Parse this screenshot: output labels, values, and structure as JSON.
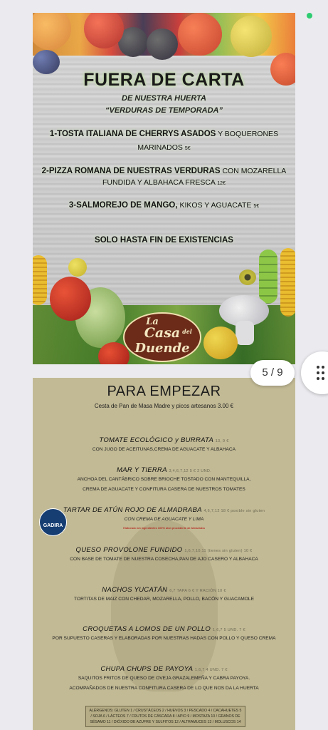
{
  "status": {
    "indicator_color": "#2ecc71"
  },
  "card_fuera": {
    "title": "FUERA DE CARTA",
    "subtitle1": "DE NUESTRA HUERTA",
    "subtitle2": "“VERDURAS DE TEMPORADA”",
    "items": [
      {
        "bold": "1-TOSTA ITALIANA DE CHERRYS ASADOS",
        "rest": " Y BOQUERONES",
        "line2": "MARINADOS",
        "price": "5€"
      },
      {
        "bold": "2-PIZZA ROMANA DE NUESTRAS VERDURAS",
        "rest": " CON MOZARELLA",
        "line2": "FUNDIDA Y ALBAHACA FRESCA",
        "price": "12€"
      },
      {
        "bold": "3-SALMOREJO DE MANGO,",
        "rest": " KIKOS Y AGUACATE",
        "price": "5€"
      }
    ],
    "note": "SOLO HASTA FIN DE EXISTENCIAS",
    "logo": {
      "line1": "La",
      "line2": "Casa",
      "line3": "del",
      "line4": "Duende"
    }
  },
  "pager": {
    "label": "5 / 9"
  },
  "card_empezar": {
    "title": "PARA EMPEZAR",
    "subtitle": "Cesta de Pan de Masa Madre y picos artesanos   3.00 €",
    "dishes": [
      {
        "name": "TOMATE ECOLÓGICO y BURRATA",
        "price": "13, 9 €",
        "desc": "CON JUGO DE ACEITUNAS,CREMA DE AGUACATE Y ALBAHACA"
      },
      {
        "name": "MAR Y TIERRA",
        "price": "3,4,6,7,12 5 € 2 UND.",
        "desc": "ANCHOA DEL CANTÁBRICO SOBRE BRIOCHE TOSTADO CON MANTEQUILLA,",
        "desc2": "CREMA DE AGUACATE Y CONFITURA CASERA DE NUESTROS TOMATES"
      },
      {
        "name": "TARTAR DE ATÚN ROJO DE ALMADRABA",
        "price": "4,6,7,12 18 € posible sin gluten",
        "desc": "CON CREMA DE AGUACATE Y LIMA",
        "note": "Elaborado sin ingredientes 100% atún procedente de Almadraba"
      },
      {
        "name": "QUESO PROVOLONE FUNDIDO",
        "price": "1,6,7,10,11 (tienes sin gluten) 10 €",
        "desc": "CON BASE DE TOMATE DE NUESTRA COSECHA,PAN DE AJO CASERO Y ALBAHACA"
      },
      {
        "name": "NACHOS YUCATÁN",
        "price": "6,7 TAPA 6 € Y RACIÓN 10 €",
        "desc": "TORTITAS DE MAIZ CON CHEDAR, MOZARELLA, POLLO, BACÓN Y GUACAMOLE"
      },
      {
        "name": "CROQUETAS A LOMOS DE UN POLLO",
        "price": "1,6,7 5 UND. 7 €",
        "desc": "POR SUPUESTO CASERAS Y ELABORADAS POR NUESTRAS HADAS CON POLLO Y QUESO CREMA"
      },
      {
        "name": "CHUPA CHUPS DE PAYOYA",
        "price": "1,6,7 4 UND. 7 €",
        "desc": "SAQUITOS FRITOS DE QUESO DE OVEJA GRAZALEMEÑA Y CABRA PAYOYA.",
        "desc2": "ACOMPAÑADOS DE NUESTRA CONFITURA CASERA DE LO QUE NOS DA LA HUERTA"
      }
    ],
    "badge": "GADIRA",
    "allergens": "ALÉRGENOS: GLUTEN 1 / CRUSTÁCEOS 2 / HUEVOS 3 / PESCADO 4 / CACAHUETES 5 / SOJA 6 / LÁCTEOS 7 / FRUTOS DE CÁSCARA 8 / APIO 9 / MOSTAZA 10 / GRANOS DE SÉSAMO 11 / DIÓXIDO DE AZUFRE Y SULFITOS 12 / ALTRAMUCES 13 / MOLUSCOS 14"
  }
}
